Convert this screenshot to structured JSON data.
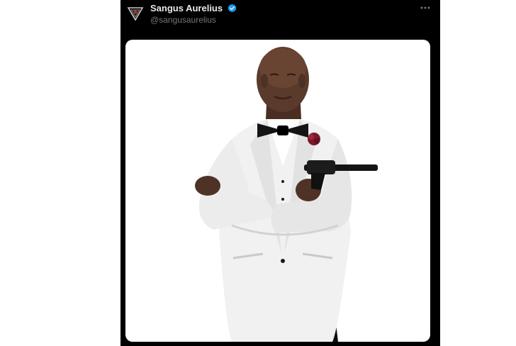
{
  "tweet": {
    "author": {
      "display_name": "Sangus Aurelius",
      "handle": "@sangusaurelius",
      "verified": true,
      "avatar_icon": "triangle-emblem-icon"
    },
    "more_icon": "ellipsis-icon",
    "media": {
      "icon": "photo",
      "subject": "man-in-white-tuxedo-with-pistol"
    }
  },
  "colors": {
    "background": "#000000",
    "name_text": "#e7e9ea",
    "handle_text": "#71767b",
    "verified_badge": "#1d9bf0"
  }
}
